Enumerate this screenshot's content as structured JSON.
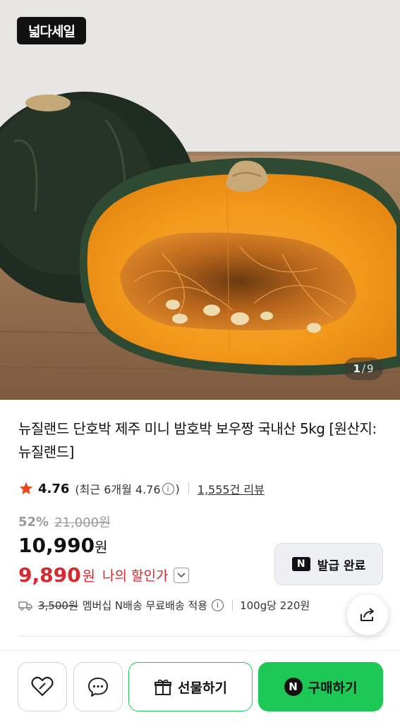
{
  "hero": {
    "badge": "넓다세일",
    "counter": {
      "current": "1",
      "separator": "/",
      "total": "9"
    }
  },
  "product": {
    "title": "뉴질랜드 단호박 제주 미니 밤호박 보우짱 국내산 5kg [원산지:뉴질랜드]",
    "rating": {
      "score": "4.76",
      "recent_prefix": "(최근 6개월 4.76",
      "recent_suffix": ")",
      "reviews": "1,555건 리뷰"
    },
    "discount": {
      "rate": "52%",
      "original_price": "21,000원"
    },
    "price": {
      "amount": "10,990",
      "unit": "원"
    },
    "my_price": {
      "amount": "9,890",
      "unit": "원",
      "label": "나의 할인가"
    },
    "coupon": {
      "label": "발급 완료",
      "n_mark": "N"
    },
    "shipping": {
      "fee": "3,500원",
      "note": "멤버십 N배송 무료배송 적용",
      "unit_price": "100g당 220원"
    }
  },
  "bottom_bar": {
    "gift_label": "선물하기",
    "buy_label": "구매하기",
    "buy_mark": "N"
  },
  "colors": {
    "accent_green": "#1dc855",
    "discount_red": "#d7282f",
    "star": "#e8481c"
  }
}
